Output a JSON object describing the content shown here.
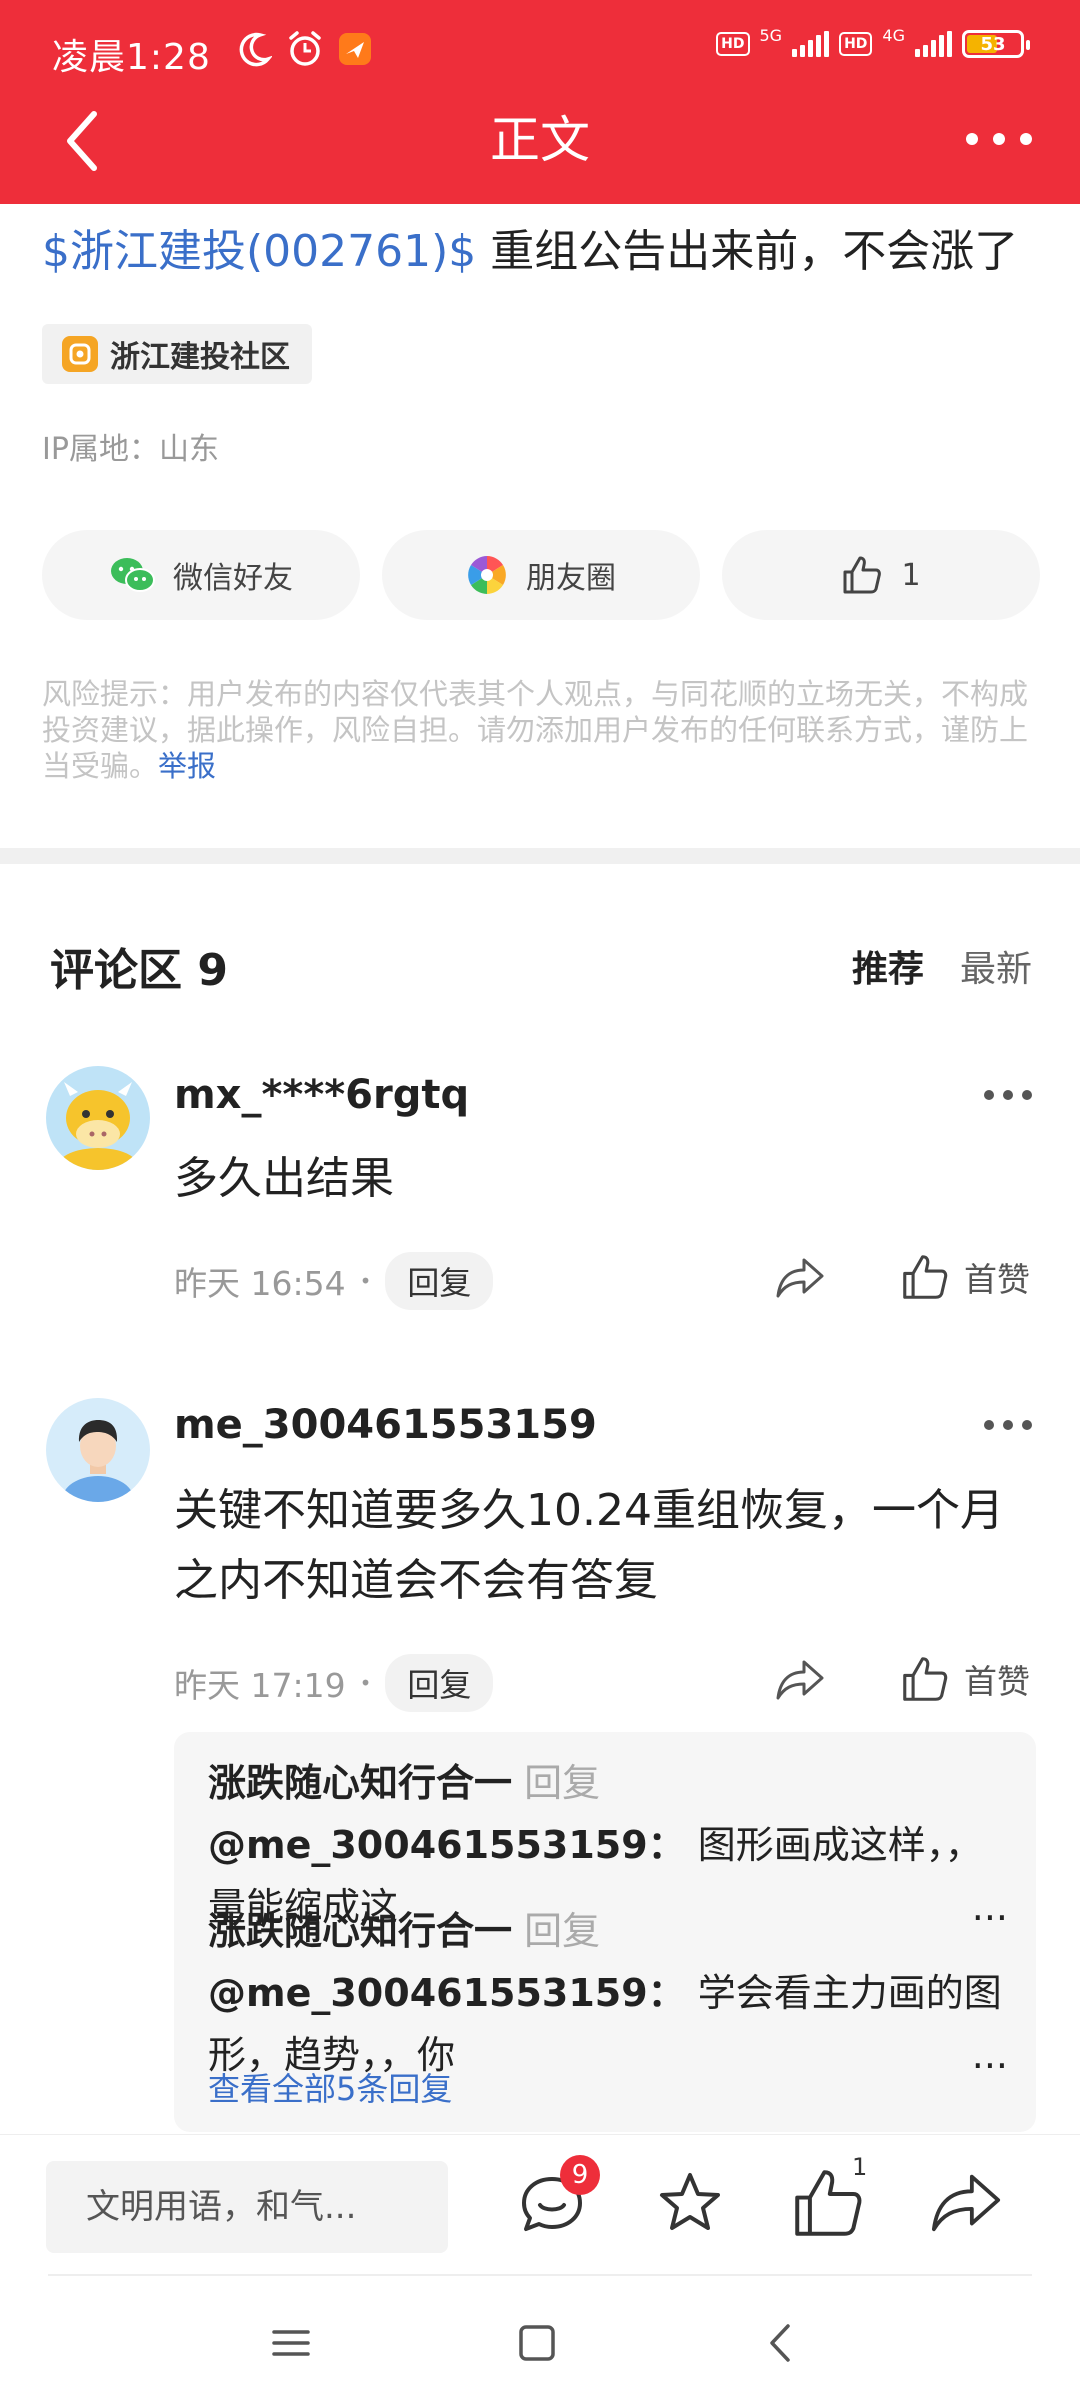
{
  "status_bar": {
    "time": "凌晨1:28",
    "signal1": "5G",
    "signal2": "4G",
    "battery": "53"
  },
  "header": {
    "title": "正文"
  },
  "article": {
    "stock_link": "$浙江建投(002761)$",
    "title_text": " 重组公告出来前，不会涨了",
    "community": "浙江建投社区",
    "ip_location": "IP属地：山东"
  },
  "share": {
    "wechat": "微信好友",
    "moments": "朋友圈",
    "like_count": "1"
  },
  "risk_notice": {
    "text": "风险提示：用户发布的内容仅代表其个人观点，与同花顺的立场无关，不构成投资建议，据此操作，风险自担。请勿添加用户发布的任何联系方式，谨防上当受骗。",
    "report": "举报"
  },
  "comments": {
    "title": "评论区 9",
    "sort_recommend": "推荐",
    "sort_latest": "最新",
    "items": [
      {
        "username": "mx_****6rgtq",
        "text": "多久出结果",
        "time": "昨天 16:54",
        "reply": "回复",
        "like_label": "首赞"
      },
      {
        "username": "me_300461553159",
        "text": "关键不知道要多久10.24重组恢复，一个月之内不知道会不会有答复",
        "time": "昨天 17:19",
        "reply": "回复",
        "like_label": "首赞",
        "replies": [
          {
            "author": "涨跌随心知行合一",
            "action": " 回复 ",
            "target": "@me_300461553159：",
            "body": " 图形画成这样，，量能缩成这",
            "ellipsis": "..."
          },
          {
            "author": "涨跌随心知行合一",
            "action": " 回复 ",
            "target": "@me_300461553159：",
            "body": " 学会看主力画的图形，趋势，，你",
            "ellipsis": "..."
          }
        ],
        "view_all": "查看全部5条回复"
      }
    ]
  },
  "bottom_bar": {
    "input_placeholder": "文明用语，和气...",
    "comment_badge": "9",
    "like_count": "1"
  },
  "colors": {
    "brand_red": "#ee2e3a",
    "link_blue": "#3a6fc9"
  }
}
